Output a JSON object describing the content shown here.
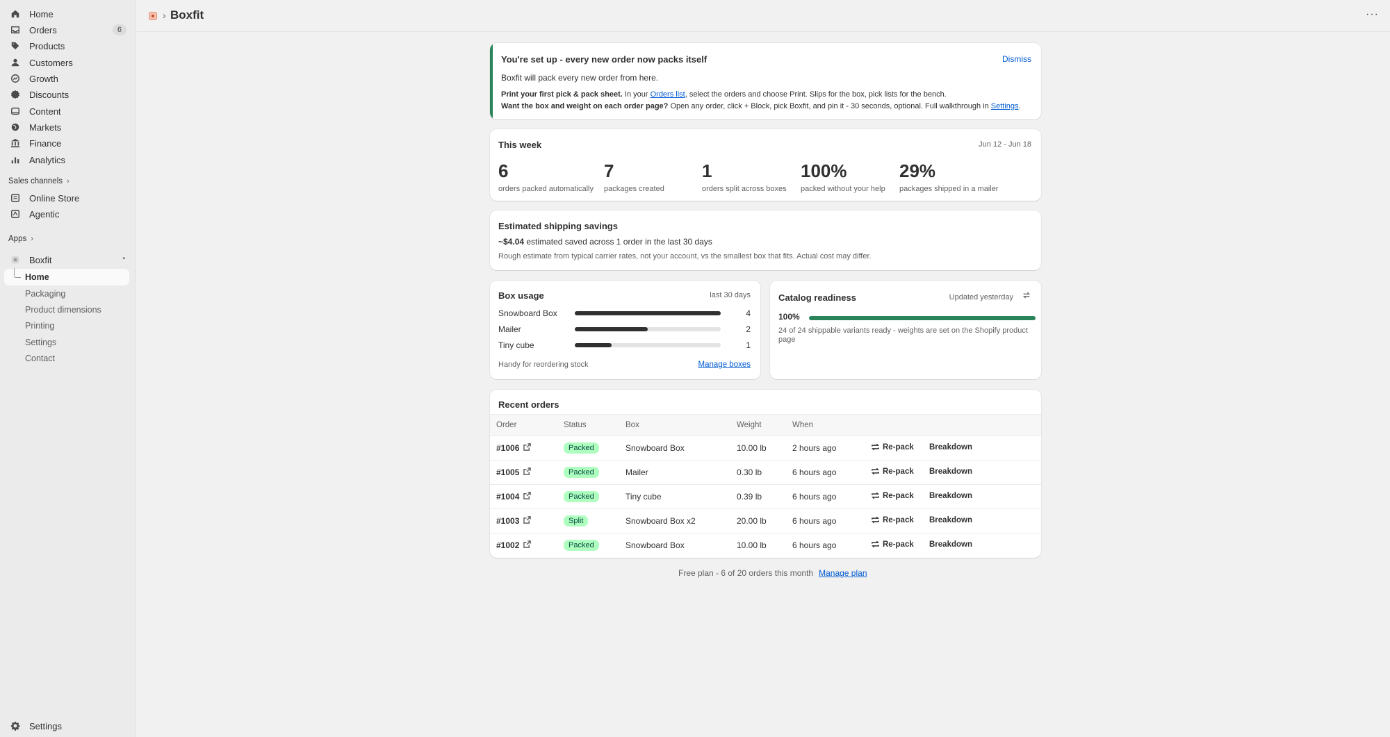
{
  "sidebar": {
    "nav": [
      {
        "label": "Home",
        "icon": "home-icon"
      },
      {
        "label": "Orders",
        "icon": "inbox-icon",
        "badge": "6"
      },
      {
        "label": "Products",
        "icon": "tag-icon"
      },
      {
        "label": "Customers",
        "icon": "person-icon"
      },
      {
        "label": "Growth",
        "icon": "growth-icon"
      },
      {
        "label": "Discounts",
        "icon": "discount-icon"
      },
      {
        "label": "Content",
        "icon": "content-icon"
      },
      {
        "label": "Markets",
        "icon": "globe-icon"
      },
      {
        "label": "Finance",
        "icon": "bank-icon"
      },
      {
        "label": "Analytics",
        "icon": "chart-icon"
      }
    ],
    "sales_channels_label": "Sales channels",
    "channels": [
      {
        "label": "Online Store",
        "icon": "store-icon"
      },
      {
        "label": "Agentic",
        "icon": "agentic-icon"
      }
    ],
    "apps_label": "Apps",
    "app_name": "Boxfit",
    "app_subitems": [
      "Home",
      "Packaging",
      "Product dimensions",
      "Printing",
      "Settings",
      "Contact"
    ],
    "settings_label": "Settings"
  },
  "header": {
    "title": "Boxfit",
    "sep": "›",
    "more": "···"
  },
  "banner": {
    "title": "You're set up - every new order now packs itself",
    "dismiss": "Dismiss",
    "line1": "Boxfit will pack every new order from here.",
    "l2_bold": "Print your first pick & pack sheet.",
    "l2_pre": " In your ",
    "l2_link": "Orders list",
    "l2_post": ", select the orders and choose Print. Slips for the box, pick lists for the bench.",
    "l3_bold": "Want the box and weight on each order page?",
    "l3_pre": " Open any order, click + Block, pick Boxfit, and pin it - 30 seconds, optional. Full walkthrough in ",
    "l3_link": "Settings",
    "l3_post": "."
  },
  "week": {
    "title": "This week",
    "range": "Jun 12 - Jun 18",
    "stats": [
      {
        "num": "6",
        "label": "orders packed automatically"
      },
      {
        "num": "7",
        "label": "packages created"
      },
      {
        "num": "1",
        "label": "orders split across boxes"
      },
      {
        "num": "100%",
        "label": "packed without your help"
      },
      {
        "num": "29%",
        "label": "packages shipped in a mailer"
      }
    ]
  },
  "savings": {
    "title": "Estimated shipping savings",
    "amount": "~$4.04",
    "amount_text": " estimated saved across 1 order in the last 30 days",
    "note": "Rough estimate from typical carrier rates, not your account, vs the smallest box that fits. Actual cost may differ."
  },
  "box_usage": {
    "title": "Box usage",
    "period": "last 30 days",
    "rows": [
      {
        "name": "Snowboard Box",
        "count": "4",
        "value": 4
      },
      {
        "name": "Mailer",
        "count": "2",
        "value": 2
      },
      {
        "name": "Tiny cube",
        "count": "1",
        "value": 1
      }
    ],
    "max": 4,
    "footer": "Handy for reordering stock",
    "manage": "Manage boxes"
  },
  "catalog": {
    "title": "Catalog readiness",
    "updated": "Updated yesterday",
    "percent": "100%",
    "fraction": 1.0,
    "note": "24 of 24 shippable variants ready - weights are set on the Shopify product page"
  },
  "recent": {
    "title": "Recent orders",
    "headers": [
      "Order",
      "Status",
      "Box",
      "Weight",
      "When"
    ],
    "repack_label": "Re-pack",
    "breakdown_label": "Breakdown",
    "rows": [
      {
        "order": "#1006",
        "status": "Packed",
        "box": "Snowboard Box",
        "weight": "10.00 lb",
        "when": "2 hours ago"
      },
      {
        "order": "#1005",
        "status": "Packed",
        "box": "Mailer",
        "weight": "0.30 lb",
        "when": "6 hours ago"
      },
      {
        "order": "#1004",
        "status": "Packed",
        "box": "Tiny cube",
        "weight": "0.39 lb",
        "when": "6 hours ago"
      },
      {
        "order": "#1003",
        "status": "Split",
        "box": "Snowboard Box x2",
        "weight": "20.00 lb",
        "when": "6 hours ago"
      },
      {
        "order": "#1002",
        "status": "Packed",
        "box": "Snowboard Box",
        "weight": "10.00 lb",
        "when": "6 hours ago"
      }
    ]
  },
  "footer": {
    "text": "Free plan - 6 of 20 orders this month",
    "link": "Manage plan"
  },
  "colors": {
    "accent": "#29845a",
    "link": "#005bd3",
    "pill_bg": "#affebf"
  }
}
